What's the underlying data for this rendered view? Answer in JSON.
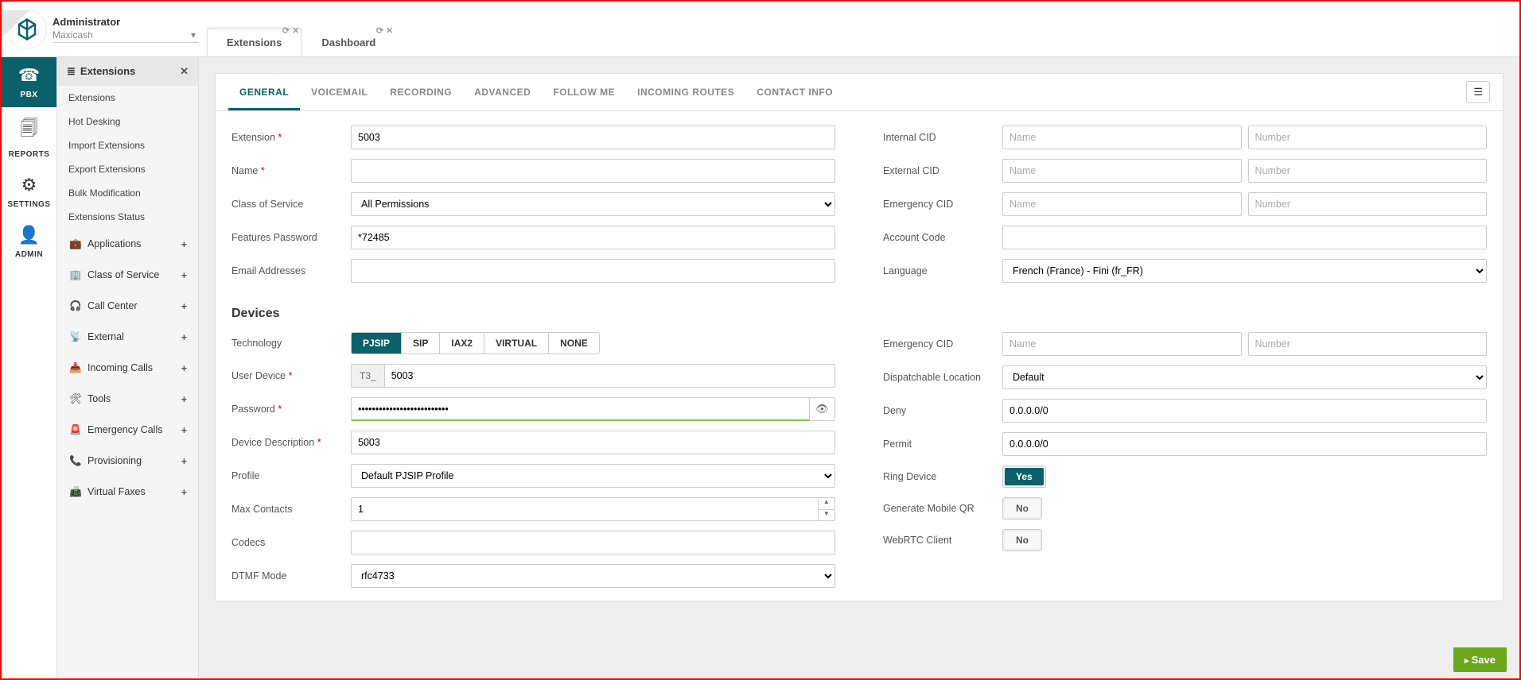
{
  "header": {
    "user": "Administrator",
    "tenant": "Maxicash"
  },
  "app_tabs": [
    {
      "label": "Extensions",
      "active": true
    },
    {
      "label": "Dashboard",
      "active": false
    }
  ],
  "nav": [
    {
      "label": "PBX",
      "icon": "phone",
      "active": true
    },
    {
      "label": "REPORTS",
      "icon": "files"
    },
    {
      "label": "SETTINGS",
      "icon": "gears"
    },
    {
      "label": "ADMIN",
      "icon": "user"
    }
  ],
  "sidebar": {
    "head": "Extensions",
    "items": [
      {
        "label": "Extensions"
      },
      {
        "label": "Hot Desking"
      },
      {
        "label": "Import Extensions"
      },
      {
        "label": "Export Extensions"
      },
      {
        "label": "Bulk Modification"
      },
      {
        "label": "Extensions Status"
      }
    ],
    "groups": [
      {
        "label": "Applications",
        "icon": "💼"
      },
      {
        "label": "Class of Service",
        "icon": "🏢"
      },
      {
        "label": "Call Center",
        "icon": "🎧"
      },
      {
        "label": "External",
        "icon": "📡"
      },
      {
        "label": "Incoming Calls",
        "icon": "📥"
      },
      {
        "label": "Tools",
        "icon": "🛠"
      },
      {
        "label": "Emergency Calls",
        "icon": "🚨"
      },
      {
        "label": "Provisioning",
        "icon": "📞"
      },
      {
        "label": "Virtual Faxes",
        "icon": "📠"
      }
    ]
  },
  "panel_tabs": [
    "GENERAL",
    "VOICEMAIL",
    "RECORDING",
    "ADVANCED",
    "FOLLOW ME",
    "INCOMING ROUTES",
    "CONTACT INFO"
  ],
  "labels": {
    "extension": "Extension",
    "name": "Name",
    "class_of_service": "Class of Service",
    "features_password": "Features Password",
    "email_addresses": "Email Addresses",
    "internal_cid": "Internal CID",
    "external_cid": "External CID",
    "emergency_cid": "Emergency CID",
    "account_code": "Account Code",
    "language": "Language",
    "devices": "Devices",
    "technology": "Technology",
    "user_device": "User Device",
    "password": "Password",
    "device_description": "Device Description",
    "profile": "Profile",
    "max_contacts": "Max Contacts",
    "codecs": "Codecs",
    "dtmf_mode": "DTMF Mode",
    "dev_emergency_cid": "Emergency CID",
    "dispatchable_location": "Dispatchable Location",
    "deny": "Deny",
    "permit": "Permit",
    "ring_device": "Ring Device",
    "generate_mobile_qr": "Generate Mobile QR",
    "webrtc_client": "WebRTC Client"
  },
  "placeholders": {
    "name": "Name",
    "number": "Number"
  },
  "values": {
    "extension": "5003",
    "name": "",
    "class_of_service": "All Permissions",
    "features_password": "*72485",
    "email_addresses": "",
    "internal_cid_name": "",
    "internal_cid_number": "",
    "external_cid_name": "",
    "external_cid_number": "",
    "emergency_cid_name": "",
    "emergency_cid_number": "",
    "account_code": "",
    "language": "French (France) - Fini (fr_FR)",
    "user_device_prefix": "T3_",
    "user_device": "5003",
    "password": "••••••••••••••••••••••••••",
    "device_description": "5003",
    "profile": "Default PJSIP Profile",
    "max_contacts": "1",
    "codecs": "",
    "dtmf_mode": "rfc4733",
    "dev_emergency_cid_name": "",
    "dev_emergency_cid_number": "",
    "dispatchable_location": "Default",
    "deny": "0.0.0.0/0",
    "permit": "0.0.0.0/0",
    "ring_device": "Yes",
    "generate_mobile_qr": "No",
    "webrtc_client": "No"
  },
  "technology_options": [
    "PJSIP",
    "SIP",
    "IAX2",
    "VIRTUAL",
    "NONE"
  ],
  "technology_selected": "PJSIP",
  "save_label": "Save"
}
